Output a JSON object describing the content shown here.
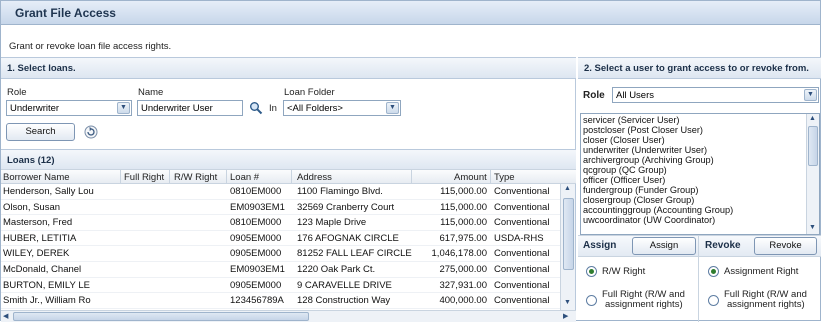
{
  "window": {
    "title": "Grant File Access"
  },
  "description": "Grant or revoke loan file access rights.",
  "left": {
    "header": "1. Select loans.",
    "filters": {
      "role_label": "Role",
      "role_value": "Underwriter",
      "name_label": "Name",
      "name_value": "Underwriter User",
      "in_label": "In",
      "folder_label": "Loan Folder",
      "folder_value": "<All Folders>"
    },
    "search_button": "Search",
    "loans_header": "Loans (12)",
    "columns": [
      "Borrower Name",
      "Full Right",
      "R/W Right",
      "Loan #",
      "Address",
      "Amount",
      "Type"
    ],
    "rows": [
      {
        "borrower": "Henderson, Sally Lou",
        "full": "",
        "rw": "",
        "loan": "0810EM000",
        "address": "1100 Flamingo Blvd.",
        "amount": "115,000.00",
        "type": "Conventional"
      },
      {
        "borrower": "Olson, Susan",
        "full": "",
        "rw": "",
        "loan": "EM0903EM1",
        "address": "32569 Cranberry Court",
        "amount": "115,000.00",
        "type": "Conventional"
      },
      {
        "borrower": "Masterson, Fred",
        "full": "",
        "rw": "",
        "loan": "0810EM000",
        "address": "123 Maple Drive",
        "amount": "115,000.00",
        "type": "Conventional"
      },
      {
        "borrower": "HUBER, LETITIA",
        "full": "",
        "rw": "",
        "loan": "0905EM000",
        "address": "176 AFOGNAK CIRCLE",
        "amount": "617,975.00",
        "type": "USDA-RHS"
      },
      {
        "borrower": "WILEY, DEREK",
        "full": "",
        "rw": "",
        "loan": "0905EM000",
        "address": "81252 FALL LEAF CIRCLE",
        "amount": "1,046,178.00",
        "type": "Conventional"
      },
      {
        "borrower": "McDonald, Chanel",
        "full": "",
        "rw": "",
        "loan": "EM0903EM1",
        "address": "1220 Oak Park Ct.",
        "amount": "275,000.00",
        "type": "Conventional"
      },
      {
        "borrower": "BURTON, EMILY LE",
        "full": "",
        "rw": "",
        "loan": "0905EM000",
        "address": "9 CARAVELLE DRIVE",
        "amount": "327,931.00",
        "type": "Conventional"
      },
      {
        "borrower": "Smith Jr., William Ro",
        "full": "",
        "rw": "",
        "loan": "123456789A",
        "address": "128 Construction Way",
        "amount": "400,000.00",
        "type": "Conventional"
      }
    ]
  },
  "right": {
    "header": "2. Select a user to grant access to or revoke from.",
    "role_label": "Role",
    "role_value": "All Users",
    "users": [
      "servicer (Servicer User)",
      "postcloser (Post Closer User)",
      "closer (Closer User)",
      "underwriter (Underwriter User)",
      "archivergroup (Archiving Group)",
      "qcgroup (QC Group)",
      "officer (Officer User)",
      "fundergroup (Funder Group)",
      "closergroup (Closer Group)",
      "accountinggroup (Accounting Group)",
      "uwcoordinator (UW Coordinator)"
    ],
    "assign_label": "Assign",
    "assign_button": "Assign",
    "revoke_label": "Revoke",
    "revoke_button": "Revoke",
    "assign_options": {
      "rw": "R/W Right",
      "full_line1": "Full Right (R/W and",
      "full_line2": "assignment rights)"
    },
    "revoke_options": {
      "assignment": "Assignment Right",
      "full_line1": "Full Right (R/W and",
      "full_line2": "assignment rights)"
    },
    "assign_selected": "rw",
    "revoke_selected": "assignment"
  }
}
